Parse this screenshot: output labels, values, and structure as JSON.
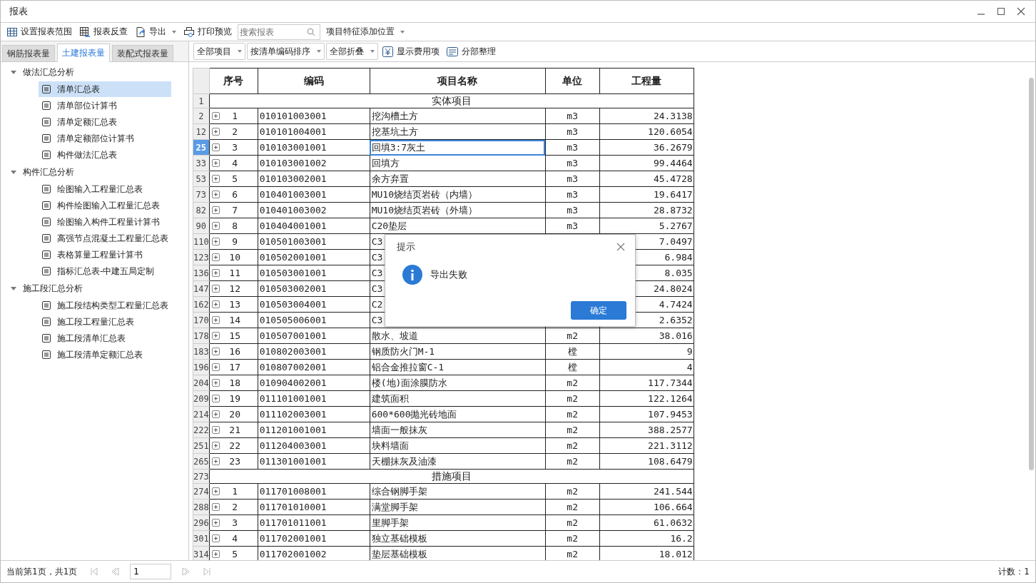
{
  "window": {
    "title": "报表"
  },
  "toolbar": [
    {
      "kind": "grid",
      "label": "设置报表范围"
    },
    {
      "kind": "lookup",
      "label": "报表反查"
    },
    {
      "kind": "export",
      "label": "导出",
      "dropdown": true
    },
    {
      "kind": "print",
      "label": "打印预览"
    }
  ],
  "search": {
    "placeholder": "搜索报表"
  },
  "position_menu": {
    "label": "项目特征添加位置"
  },
  "tabs": [
    {
      "label": "钢筋报表量",
      "selected": false
    },
    {
      "label": "土建报表量",
      "selected": true
    },
    {
      "label": "装配式报表量",
      "selected": false
    }
  ],
  "filters": [
    {
      "kind": "dropdown",
      "label": "全部项目"
    },
    {
      "kind": "dropdown",
      "label": "按清单编码排序"
    },
    {
      "kind": "dropdown",
      "label": "全部折叠"
    },
    {
      "kind": "yen",
      "label": "显示费用项"
    },
    {
      "kind": "sort",
      "label": "分部整理"
    }
  ],
  "tree": [
    {
      "label": "做法汇总分析",
      "expanded": true,
      "children": [
        {
          "label": "清单汇总表",
          "selected": true
        },
        {
          "label": "清单部位计算书",
          "selected": false
        },
        {
          "label": "清单定额汇总表",
          "selected": false
        },
        {
          "label": "清单定额部位计算书",
          "selected": false
        },
        {
          "label": "构件做法汇总表",
          "selected": false
        }
      ]
    },
    {
      "label": "构件汇总分析",
      "expanded": true,
      "children": [
        {
          "label": "绘图输入工程量汇总表",
          "selected": false
        },
        {
          "label": "构件绘图输入工程量汇总表",
          "selected": false
        },
        {
          "label": "绘图输入构件工程量计算书",
          "selected": false
        },
        {
          "label": "高强节点混凝土工程量汇总表",
          "selected": false
        },
        {
          "label": "表格算量工程量计算书",
          "selected": false
        },
        {
          "label": "指标汇总表-中建五局定制",
          "selected": false
        }
      ]
    },
    {
      "label": "施工段汇总分析",
      "expanded": true,
      "children": [
        {
          "label": "施工段结构类型工程量汇总表",
          "selected": false
        },
        {
          "label": "施工段工程量汇总表",
          "selected": false
        },
        {
          "label": "施工段清单汇总表",
          "selected": false
        },
        {
          "label": "施工段清单定额汇总表",
          "selected": false
        }
      ]
    }
  ],
  "table": {
    "columns": [
      "序号",
      "编码",
      "项目名称",
      "单位",
      "工程量"
    ],
    "rows": [
      {
        "kind": "section",
        "row": "1",
        "name": "实体项目"
      },
      {
        "kind": "item",
        "row": "2",
        "no": "1",
        "code": "010101003001",
        "name": "挖沟槽土方",
        "unit": "m3",
        "qty": "24.3138",
        "selected": false
      },
      {
        "kind": "item",
        "row": "12",
        "no": "2",
        "code": "010101004001",
        "name": "挖基坑土方",
        "unit": "m3",
        "qty": "120.6054",
        "selected": false
      },
      {
        "kind": "item",
        "row": "25",
        "no": "3",
        "code": "010103001001",
        "name": "回填3:7灰土",
        "unit": "m3",
        "qty": "36.2679",
        "selected": true
      },
      {
        "kind": "item",
        "row": "33",
        "no": "4",
        "code": "010103001002",
        "name": "回填方",
        "unit": "m3",
        "qty": "99.4464",
        "selected": false
      },
      {
        "kind": "item",
        "row": "53",
        "no": "5",
        "code": "010103002001",
        "name": "余方弃置",
        "unit": "m3",
        "qty": "45.4728",
        "selected": false
      },
      {
        "kind": "item",
        "row": "73",
        "no": "6",
        "code": "010401003001",
        "name": "MU10烧结页岩砖（内墙）",
        "unit": "m3",
        "qty": "19.6417",
        "selected": false
      },
      {
        "kind": "item",
        "row": "82",
        "no": "7",
        "code": "010401003002",
        "name": "MU10烧结页岩砖（外墙）",
        "unit": "m3",
        "qty": "28.8732",
        "selected": false
      },
      {
        "kind": "item",
        "row": "90",
        "no": "8",
        "code": "010404001001",
        "name": "C20垫层",
        "unit": "m3",
        "qty": "5.2767",
        "selected": false
      },
      {
        "kind": "item",
        "row": "110",
        "no": "9",
        "code": "010501003001",
        "name": "C3",
        "qty": "7.0497",
        "selected": false
      },
      {
        "kind": "item",
        "row": "123",
        "no": "10",
        "code": "010502001001",
        "name": "C3",
        "qty": "6.984",
        "selected": false
      },
      {
        "kind": "item",
        "row": "136",
        "no": "11",
        "code": "010503001001",
        "name": "C3",
        "qty": "8.035",
        "selected": false
      },
      {
        "kind": "item",
        "row": "147",
        "no": "12",
        "code": "010503002001",
        "name": "C3",
        "qty": "24.8024",
        "selected": false
      },
      {
        "kind": "item",
        "row": "162",
        "no": "13",
        "code": "010503004001",
        "name": "C2",
        "qty": "4.7424",
        "selected": false
      },
      {
        "kind": "item",
        "row": "170",
        "no": "14",
        "code": "010505006001",
        "name": "C3",
        "qty": "2.6352",
        "selected": false
      },
      {
        "kind": "item",
        "row": "178",
        "no": "15",
        "code": "010507001001",
        "name": "散水、坡道",
        "unit": "m2",
        "qty": "38.016",
        "selected": false
      },
      {
        "kind": "item",
        "row": "183",
        "no": "16",
        "code": "010802003001",
        "name": "钢质防火门M-1",
        "unit": "樘",
        "qty": "9",
        "selected": false
      },
      {
        "kind": "item",
        "row": "196",
        "no": "17",
        "code": "010807002001",
        "name": "铝合金推拉窗C-1",
        "unit": "樘",
        "qty": "4",
        "selected": false
      },
      {
        "kind": "item",
        "row": "204",
        "no": "18",
        "code": "010904002001",
        "name": "楼(地)面涂膜防水",
        "unit": "m2",
        "qty": "117.7344",
        "selected": false
      },
      {
        "kind": "item",
        "row": "209",
        "no": "19",
        "code": "011101001001",
        "name": "建筑面积",
        "unit": "m2",
        "qty": "122.1264",
        "selected": false
      },
      {
        "kind": "item",
        "row": "214",
        "no": "20",
        "code": "011102003001",
        "name": "600*600抛光砖地面",
        "unit": "m2",
        "qty": "107.9453",
        "selected": false
      },
      {
        "kind": "item",
        "row": "222",
        "no": "21",
        "code": "011201001001",
        "name": "墙面一般抹灰",
        "unit": "m2",
        "qty": "388.2577",
        "selected": false
      },
      {
        "kind": "item",
        "row": "251",
        "no": "22",
        "code": "011204003001",
        "name": "块料墙面",
        "unit": "m2",
        "qty": "221.3112",
        "selected": false
      },
      {
        "kind": "item",
        "row": "265",
        "no": "23",
        "code": "011301001001",
        "name": "天棚抹灰及油漆",
        "unit": "m2",
        "qty": "108.6479",
        "selected": false
      },
      {
        "kind": "section",
        "row": "273",
        "name": "措施项目"
      },
      {
        "kind": "item",
        "row": "274",
        "no": "1",
        "code": "011701008001",
        "name": "综合钢脚手架",
        "unit": "m2",
        "qty": "241.544",
        "selected": false
      },
      {
        "kind": "item",
        "row": "288",
        "no": "2",
        "code": "011701010001",
        "name": "满堂脚手架",
        "unit": "m2",
        "qty": "106.664",
        "selected": false
      },
      {
        "kind": "item",
        "row": "296",
        "no": "3",
        "code": "011701011001",
        "name": "里脚手架",
        "unit": "m2",
        "qty": "61.0632",
        "selected": false
      },
      {
        "kind": "item",
        "row": "301",
        "no": "4",
        "code": "011702001001",
        "name": "独立基础模板",
        "unit": "m2",
        "qty": "16.2",
        "selected": false
      },
      {
        "kind": "item",
        "row": "314",
        "no": "5",
        "code": "011702001002",
        "name": "垫层基础模板",
        "unit": "m2",
        "qty": "18.012",
        "selected": false
      }
    ]
  },
  "dialog": {
    "title": "提示",
    "message": "导出失败",
    "button": "确定"
  },
  "status_bar": {
    "page_info": "当前第1页，共1页",
    "page": "1",
    "count": "计数：1"
  }
}
